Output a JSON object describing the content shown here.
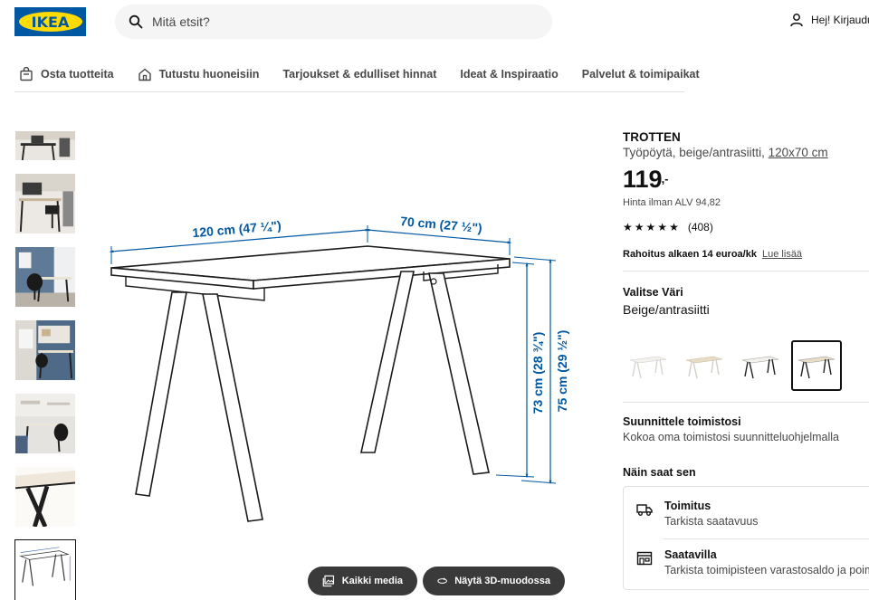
{
  "header": {
    "logo_text": "IKEA",
    "search_placeholder": "Mitä etsit?",
    "login_text": "Hej! Kirjaudu"
  },
  "nav": {
    "items": [
      {
        "label": "Osta tuotteita",
        "icon": "bag-icon"
      },
      {
        "label": "Tutustu huoneisiin",
        "icon": "home-icon"
      },
      {
        "label": "Tarjoukset & edulliset hinnat"
      },
      {
        "label": "Ideat & Inspiraatio"
      },
      {
        "label": "Palvelut & toimipaikat"
      }
    ]
  },
  "gallery": {
    "thumbnail_count": 7,
    "active_index": 6,
    "buttons": {
      "all_media": "Kaikki media",
      "view_3d": "Näytä 3D-muodossa"
    },
    "dimensions": {
      "width": "120 cm (47 ¼\")",
      "depth": "70 cm (27 ½\")",
      "height_inner": "73 cm (28 ¾\")",
      "height_outer": "75 cm (29 ½\")"
    }
  },
  "product": {
    "name": "TROTTEN",
    "description": "Työpöytä, beige/antrasiitti,",
    "size": "120x70 cm",
    "price": "119",
    "price_suffix": ",-",
    "vat_text": "Hinta ilman ALV 94,82",
    "rating_stars": 5,
    "rating_count": "(408)",
    "finance_text": "Rahoitus alkaen 14 euroa/kk",
    "finance_link": "Lue lisää"
  },
  "color": {
    "title": "Valitse Väri",
    "selected": "Beige/antrasiitti",
    "swatch_count": 4,
    "selected_index": 3
  },
  "plan": {
    "title": "Suunnittele toimistosi",
    "subtitle": "Kokoa oma toimistosi suunnitteluohjelmalla"
  },
  "availability": {
    "title": "Näin saat sen",
    "delivery_title": "Toimitus",
    "delivery_sub": "Tarkista saatavuus",
    "store_title": "Saatavilla",
    "store_sub": "Tarkista toimipisteen varastosaldo ja poimi"
  },
  "colors": {
    "ikea_blue": "#0058a3",
    "ikea_yellow": "#ffdb00",
    "dimension_blue": "#0058a3"
  }
}
